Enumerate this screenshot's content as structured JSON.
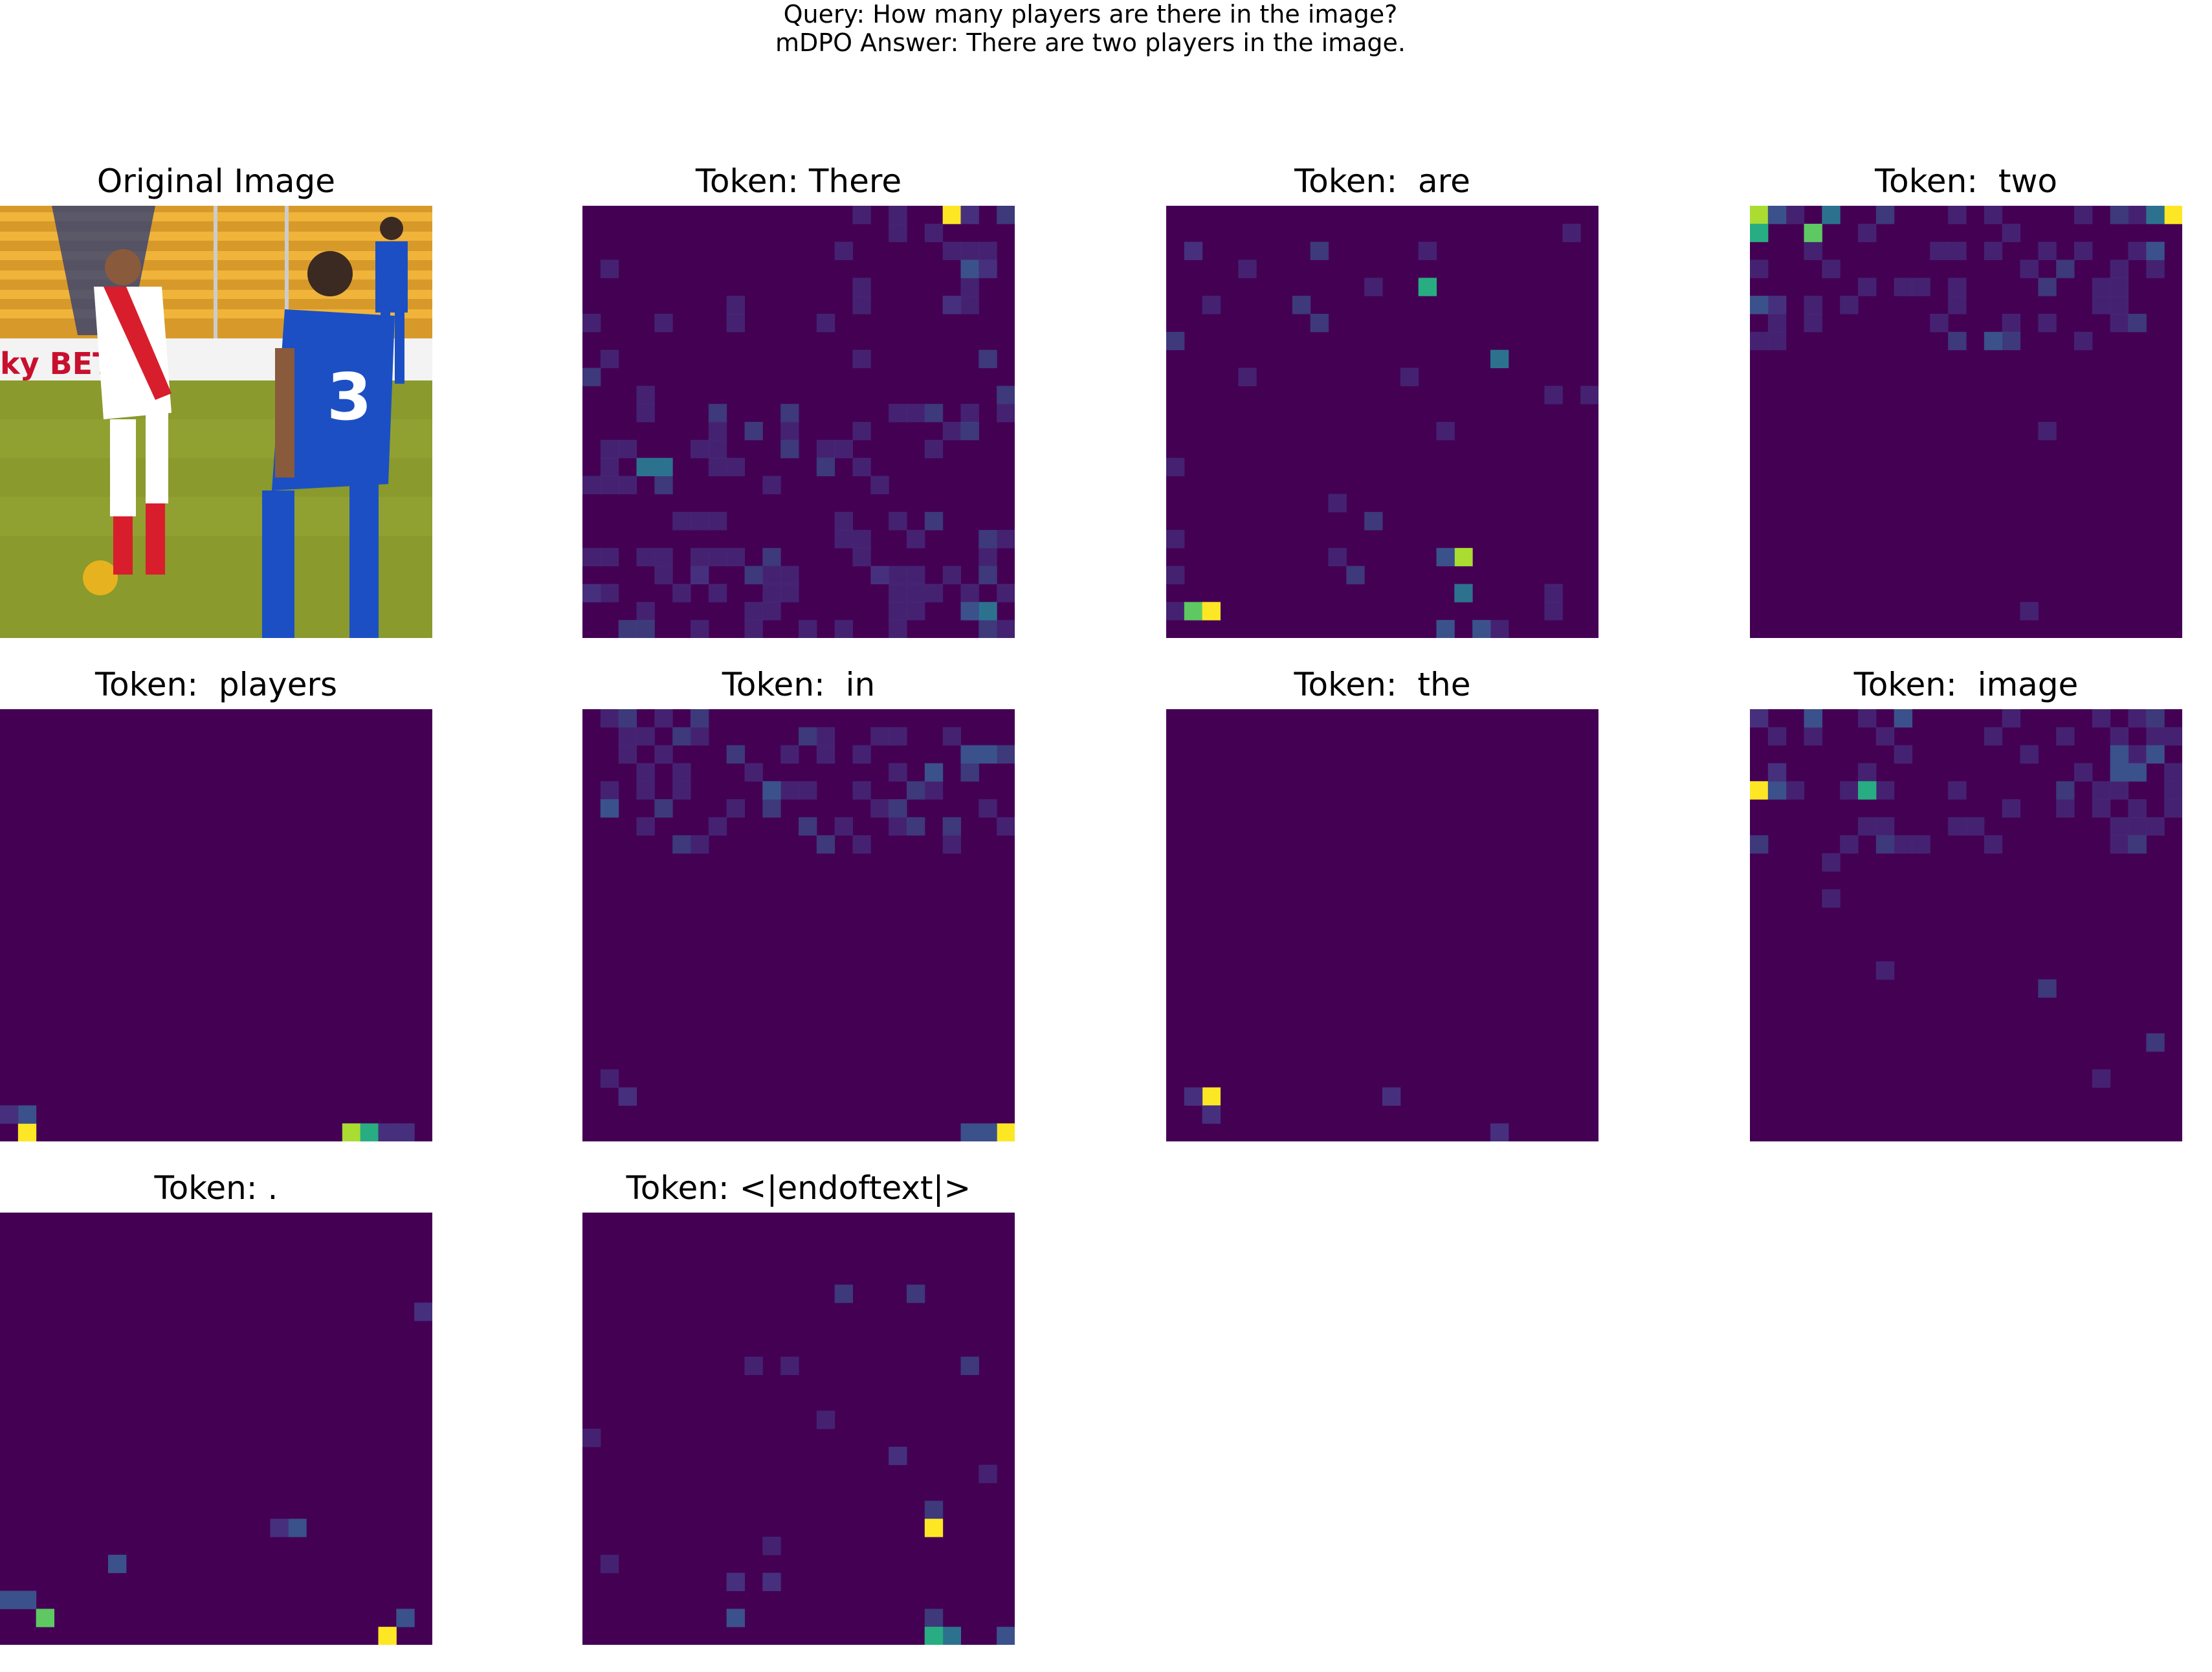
{
  "figure": {
    "query": "Query: How many players are there in the image?",
    "answer": "mDPO Answer: There are two players in the image."
  },
  "colors": {
    "base": "#440154",
    "low": "#46307e",
    "mid_low": "#3b518b",
    "mid": "#2c728e",
    "teal": "#21918c",
    "green": "#27ad81",
    "lime": "#5ec962",
    "yellow_green": "#aadc32",
    "yellow": "#fde725"
  },
  "panels": [
    {
      "title": "Original Image",
      "kind": "photo"
    },
    {
      "title": "Token: There",
      "kind": "heatmap"
    },
    {
      "title": "Token:  are",
      "kind": "heatmap"
    },
    {
      "title": "Token:  two",
      "kind": "heatmap"
    },
    {
      "title": "Token:  players",
      "kind": "heatmap"
    },
    {
      "title": "Token:  in",
      "kind": "heatmap"
    },
    {
      "title": "Token:  the",
      "kind": "heatmap"
    },
    {
      "title": "Token:  image",
      "kind": "heatmap"
    },
    {
      "title": "Token: .",
      "kind": "heatmap"
    },
    {
      "title": "Token: <|endoftext|>",
      "kind": "heatmap"
    }
  ]
}
